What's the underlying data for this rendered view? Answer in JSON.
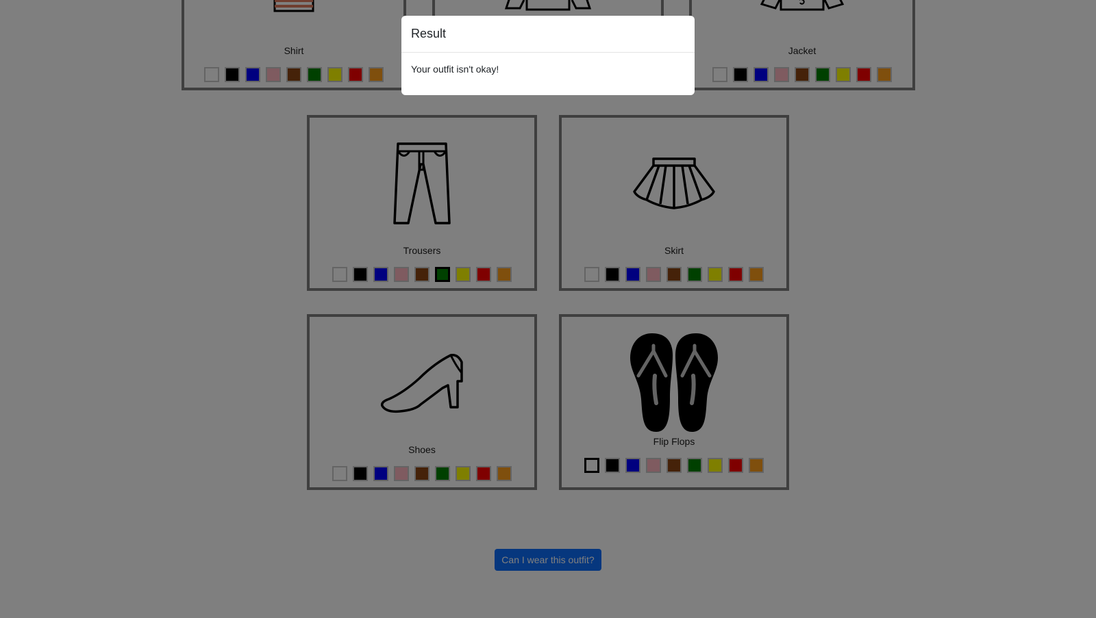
{
  "cards": {
    "shirt": {
      "label": "Shirt",
      "selected_color": null
    },
    "top": {
      "label": "",
      "selected_color": null
    },
    "jacket": {
      "label": "Jacket",
      "selected_color": null
    },
    "trousers": {
      "label": "Trousers",
      "selected_color": "green"
    },
    "skirt": {
      "label": "Skirt",
      "selected_color": null
    },
    "shoes": {
      "label": "Shoes",
      "selected_color": null
    },
    "flipflops": {
      "label": "Flip Flops",
      "selected_color": "white"
    }
  },
  "swatch_colors": [
    {
      "name": "white",
      "hex": "#ffffff"
    },
    {
      "name": "black",
      "hex": "#000000"
    },
    {
      "name": "blue",
      "hex": "#0000ff"
    },
    {
      "name": "pink",
      "hex": "#ffb6c1"
    },
    {
      "name": "brown",
      "hex": "#8b4513"
    },
    {
      "name": "green",
      "hex": "#008000"
    },
    {
      "name": "yellow",
      "hex": "#ffff00"
    },
    {
      "name": "red",
      "hex": "#ff0000"
    },
    {
      "name": "orange",
      "hex": "#ff9f1a"
    }
  ],
  "submit_button": {
    "label": "Can I wear this outfit?"
  },
  "modal": {
    "title": "Result",
    "message": "Your outfit isn't okay!"
  },
  "colors": {
    "primary": "#0d6efd",
    "overlay": "rgba(0,0,0,0.5)"
  }
}
